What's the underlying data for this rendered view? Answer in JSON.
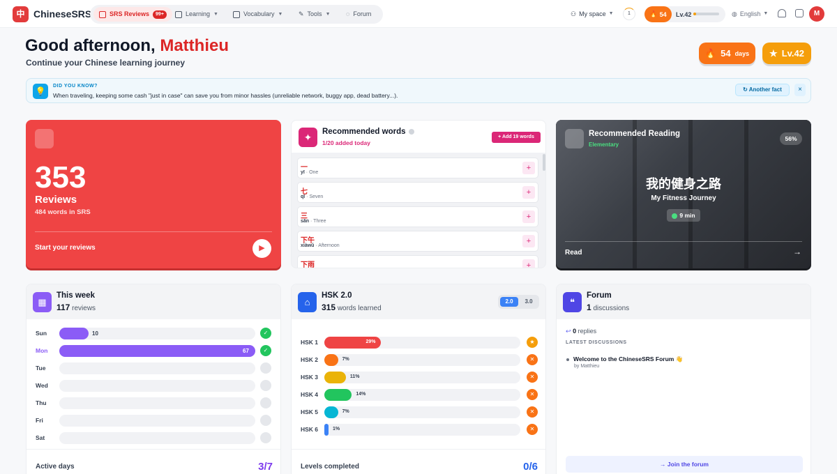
{
  "app": {
    "logo": "中",
    "name": "ChineseSRS"
  },
  "nav": {
    "srs": "SRS Reviews",
    "srs_badge": "99+",
    "learning": "Learning",
    "vocabulary": "Vocabulary",
    "tools": "Tools",
    "forum": "Forum"
  },
  "topright": {
    "myspace": "My space",
    "circle": "1",
    "streak": "54",
    "level": "Lv.42",
    "level_progress": 0.12,
    "language": "English",
    "avatar": "M"
  },
  "greeting": {
    "prefix": "Good afternoon,",
    "name": "Matthieu",
    "subtitle": "Continue your Chinese learning journey"
  },
  "stats": {
    "streak_num": "54",
    "streak_unit": "days",
    "level": "Lv.42"
  },
  "tip": {
    "heading": "DID YOU KNOW?",
    "text": "When traveling, keeping some cash \"just in case\" can save you from minor hassles (unreliable network, buggy app, dead battery...).",
    "another": "Another fact",
    "close": "×"
  },
  "reviews": {
    "count": "353",
    "label": "Reviews",
    "words": "484 words in SRS",
    "start": "Start your reviews"
  },
  "recommended_words": {
    "title": "Recommended words",
    "added": "1/20 added today",
    "add_button": "Add 19 words",
    "items": [
      {
        "hanzi": "一",
        "pinyin": "yī",
        "meaning": "One"
      },
      {
        "hanzi": "七",
        "pinyin": "qī",
        "meaning": "Seven"
      },
      {
        "hanzi": "三",
        "pinyin": "sān",
        "meaning": "Three"
      },
      {
        "hanzi": "下午",
        "pinyin": "xiàwǔ",
        "meaning": "Afternoon"
      },
      {
        "hanzi": "下雨",
        "pinyin": "",
        "meaning": ""
      }
    ]
  },
  "reading": {
    "title": "Recommended Reading",
    "level": "Elementary",
    "percent": "56%",
    "cn_title": "我的健身之路",
    "en_title": "My Fitness Journey",
    "duration": "9 min",
    "read": "Read"
  },
  "week": {
    "title": "This week",
    "count": "117",
    "count_label": "reviews",
    "max": 67,
    "days": [
      {
        "name": "Sun",
        "value": 10,
        "done": true
      },
      {
        "name": "Mon",
        "value": 67,
        "done": true
      },
      {
        "name": "Tue",
        "value": 0,
        "done": false
      },
      {
        "name": "Wed",
        "value": 0,
        "done": false
      },
      {
        "name": "Thu",
        "value": 0,
        "done": false
      },
      {
        "name": "Fri",
        "value": 0,
        "done": false
      },
      {
        "name": "Sat",
        "value": 0,
        "done": false
      }
    ],
    "footer_label": "Active days",
    "footer_value": "3/7"
  },
  "hsk": {
    "title": "HSK 2.0",
    "count": "315",
    "count_label": "words learned",
    "versions": [
      "2.0",
      "3.0"
    ],
    "levels": [
      {
        "name": "HSK 1",
        "pct": 29,
        "label": "29%",
        "color": "#ef4444",
        "medal": "#f59e0b"
      },
      {
        "name": "HSK 2",
        "pct": 7,
        "label": "7%",
        "color": "#f97316",
        "medal": "#f97316"
      },
      {
        "name": "HSK 3",
        "pct": 11,
        "label": "11%",
        "color": "#eab308",
        "medal": "#f97316"
      },
      {
        "name": "HSK 4",
        "pct": 14,
        "label": "14%",
        "color": "#22c55e",
        "medal": "#f97316"
      },
      {
        "name": "HSK 5",
        "pct": 7,
        "label": "7%",
        "color": "#06b6d4",
        "medal": "#f97316"
      },
      {
        "name": "HSK 6",
        "pct": 1,
        "label": "1%",
        "color": "#3b82f6",
        "medal": "#f97316"
      }
    ],
    "footer_label": "Levels completed",
    "footer_value": "0/6"
  },
  "forum": {
    "title": "Forum",
    "count": "1",
    "count_label": "discussions",
    "replies_num": "0",
    "replies_label": "replies",
    "latest": "LATEST DISCUSSIONS",
    "post": "Welcome to the ChineseSRS Forum 👋",
    "by": "by Matthieu",
    "join": "Join the forum"
  }
}
